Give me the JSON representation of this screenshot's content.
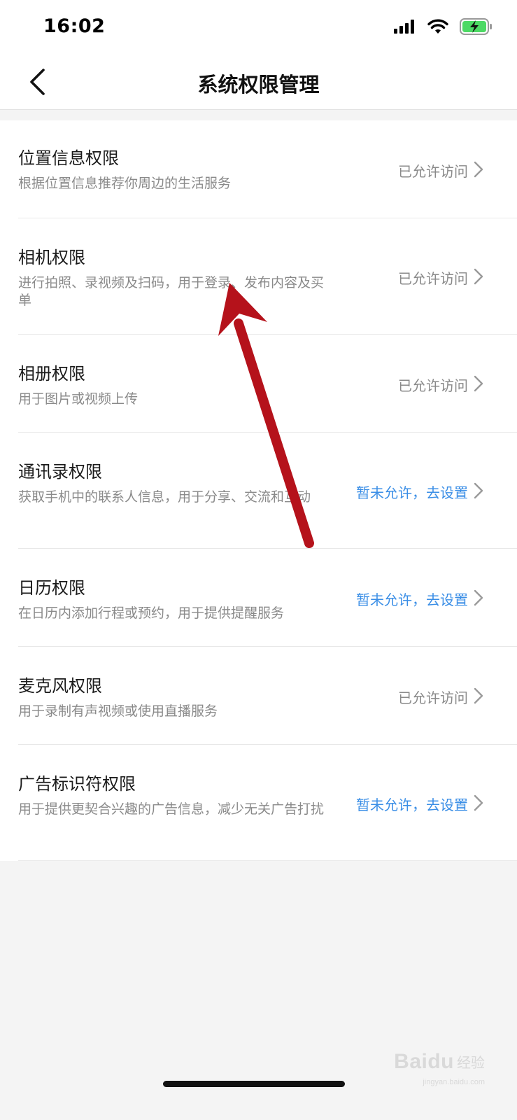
{
  "status_bar": {
    "time": "16:02",
    "icons": [
      "cellular-signal-icon",
      "wifi-icon",
      "battery-charging-icon"
    ],
    "battery_color": "#4cd964"
  },
  "nav": {
    "title": "系统权限管理",
    "back_icon": "chevron-left-icon"
  },
  "colors": {
    "allowed": "#8a8a8a",
    "denied": "#3a8ee6",
    "annotation_arrow": "#b5121b"
  },
  "permissions": [
    {
      "title": "位置信息权限",
      "description": "根据位置信息推荐你周边的生活服务",
      "status": "已允许访问",
      "allowed": true
    },
    {
      "title": "相机权限",
      "description": "进行拍照、录视频及扫码，用于登录、发布内容及买单",
      "status": "已允许访问",
      "allowed": true
    },
    {
      "title": "相册权限",
      "description": "用于图片或视频上传",
      "status": "已允许访问",
      "allowed": true
    },
    {
      "title": "通讯录权限",
      "description": "获取手机中的联系人信息，用于分享、交流和互动",
      "status": "暂未允许，去设置",
      "allowed": false
    },
    {
      "title": "日历权限",
      "description": "在日历内添加行程或预约，用于提供提醒服务",
      "status": "暂未允许，去设置",
      "allowed": false
    },
    {
      "title": "麦克风权限",
      "description": "用于录制有声视频或使用直播服务",
      "status": "已允许访问",
      "allowed": true
    },
    {
      "title": "广告标识符权限",
      "description": "用于提供更契合兴趣的广告信息，减少无关广告打扰",
      "status": "暂未允许，去设置",
      "allowed": false
    }
  ],
  "watermark": {
    "brand": "Baidu",
    "sub": "经验",
    "url": "jingyan.baidu.com"
  }
}
